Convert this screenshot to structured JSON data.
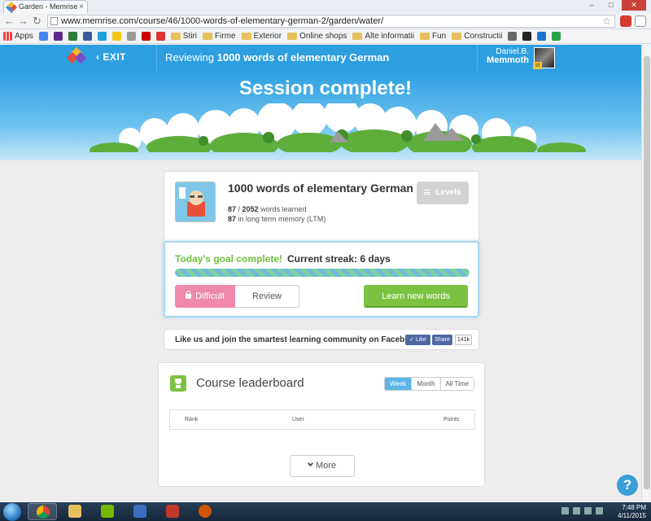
{
  "browser": {
    "tab_title": "Garden - Memrise",
    "tab_close": "×",
    "url": "www.memrise.com/course/46/1000-words-of-elementary-german-2/garden/water/",
    "window_buttons": [
      "–",
      "□",
      "✕"
    ],
    "bookmarks": [
      "Apps",
      "Stiri",
      "Firme",
      "Exterior",
      "Online shops",
      "Alte informatii",
      "Fun",
      "Constructii"
    ],
    "nav_glyphs": [
      "←",
      "→",
      "↻"
    ],
    "star": "☆"
  },
  "header": {
    "exit_label": "EXIT",
    "reviewing_prefix": "Reviewing",
    "course_name": "1000 words of elementary German",
    "user_name": "Daniel.B.",
    "user_rank": "Memmoth",
    "avatar_level": "sl"
  },
  "hero": {
    "title": "Session complete!"
  },
  "course": {
    "title": "1000 words of elementary German",
    "words_learned": "87",
    "words_total": "2052",
    "words_label": "words learned",
    "ltm_count": "87",
    "ltm_label": "in long term memory (LTM)",
    "levels_label": "Levels"
  },
  "goal": {
    "goal_text": "Today's goal complete!",
    "streak_text": "Current streak: 6 days",
    "progress": 1.0,
    "difficult_label": "Difficult",
    "review_label": "Review",
    "learn_label": "Learn new words"
  },
  "facebook": {
    "text": "Like us and join the smartest learning community on Facebook!",
    "like_label": "Like",
    "share_label": "Share",
    "count": "141k"
  },
  "leaderboard": {
    "title": "Course leaderboard",
    "tabs": [
      "Week",
      "Month",
      "All Time"
    ],
    "active_tab": "Week",
    "columns": [
      "Rank",
      "User",
      "Points"
    ],
    "more_label": "More"
  },
  "help": {
    "label": "?"
  },
  "taskbar": {
    "time": "7:48 PM",
    "date": "4/11/2015"
  },
  "colors": {
    "brand_blue": "#2d9fe0",
    "goal_green": "#6fbf3a",
    "learn_green": "#7cc242",
    "difficult_pink": "#ee89ad"
  }
}
